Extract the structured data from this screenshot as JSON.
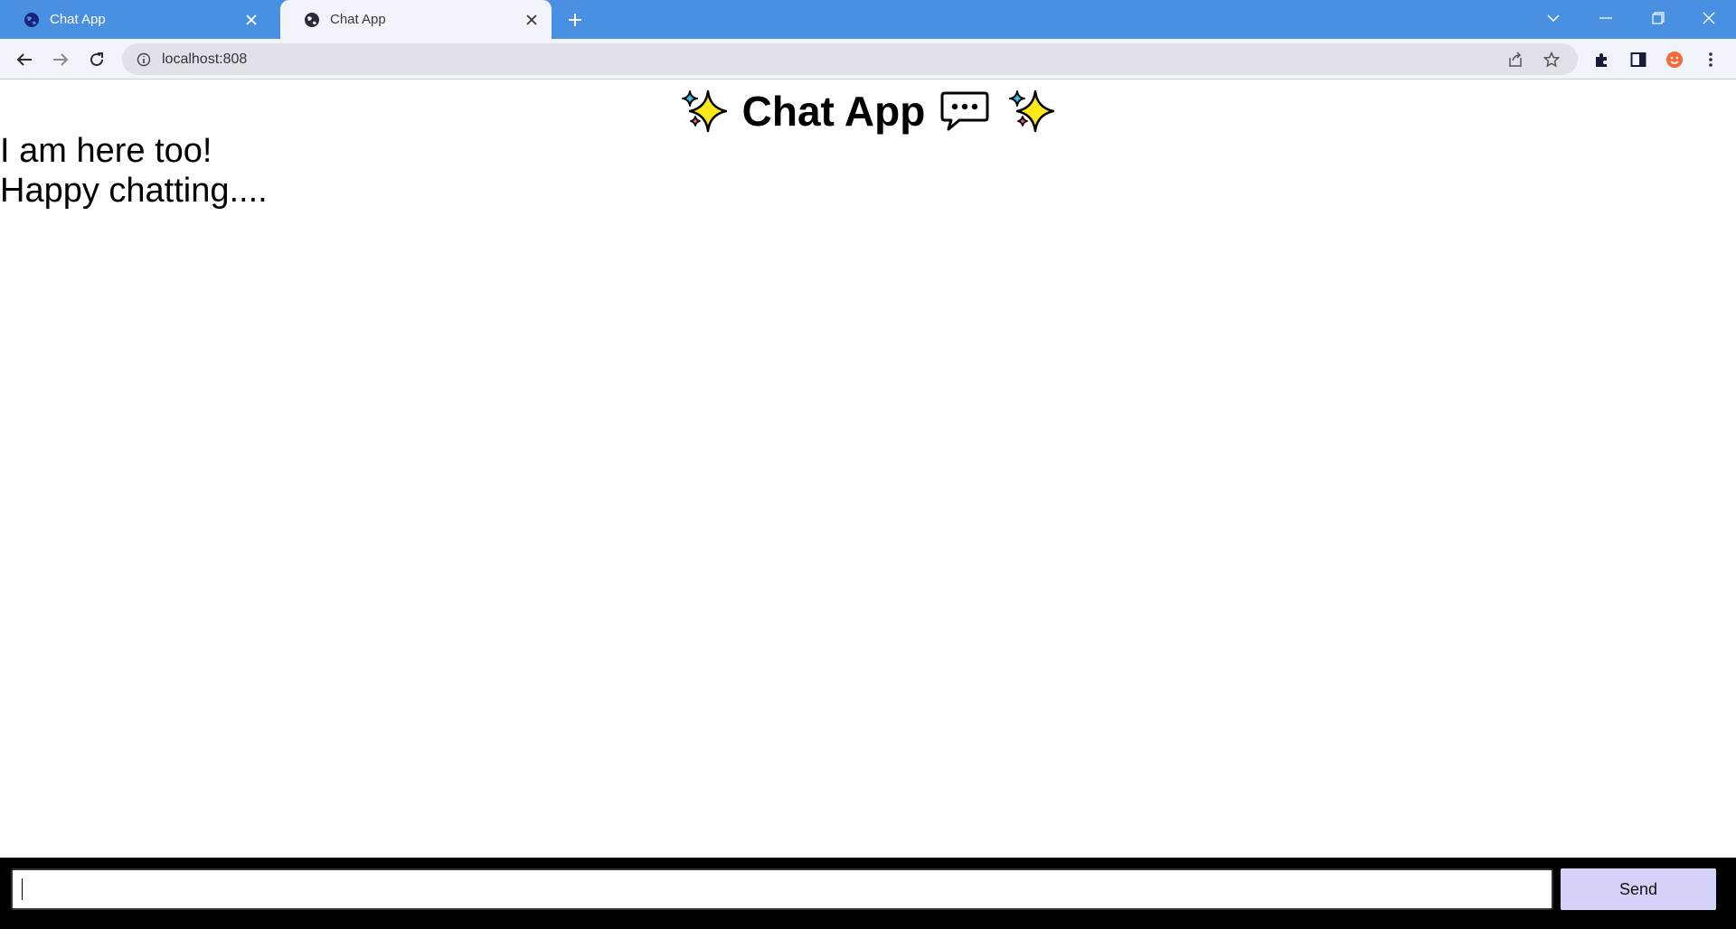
{
  "tabs": [
    {
      "title": "Chat App",
      "active": false
    },
    {
      "title": "Chat App",
      "active": true
    }
  ],
  "toolbar": {
    "url": "localhost:808"
  },
  "page": {
    "title": "Chat App",
    "title_icons": [
      "sparkles-icon",
      "speech-balloon-icon",
      "sparkles-icon"
    ],
    "messages": [
      "I am here too!",
      "Happy chatting...."
    ]
  },
  "composer": {
    "input_value": "",
    "send_label": "Send"
  },
  "colors": {
    "tabstrip": "#4a90e2",
    "toolbar": "#f1f5fb",
    "omnibox": "#dfe3e9",
    "composer_bg": "#000000",
    "send_button": "#d6d3fb",
    "profile_accent": "#f26b3a"
  }
}
